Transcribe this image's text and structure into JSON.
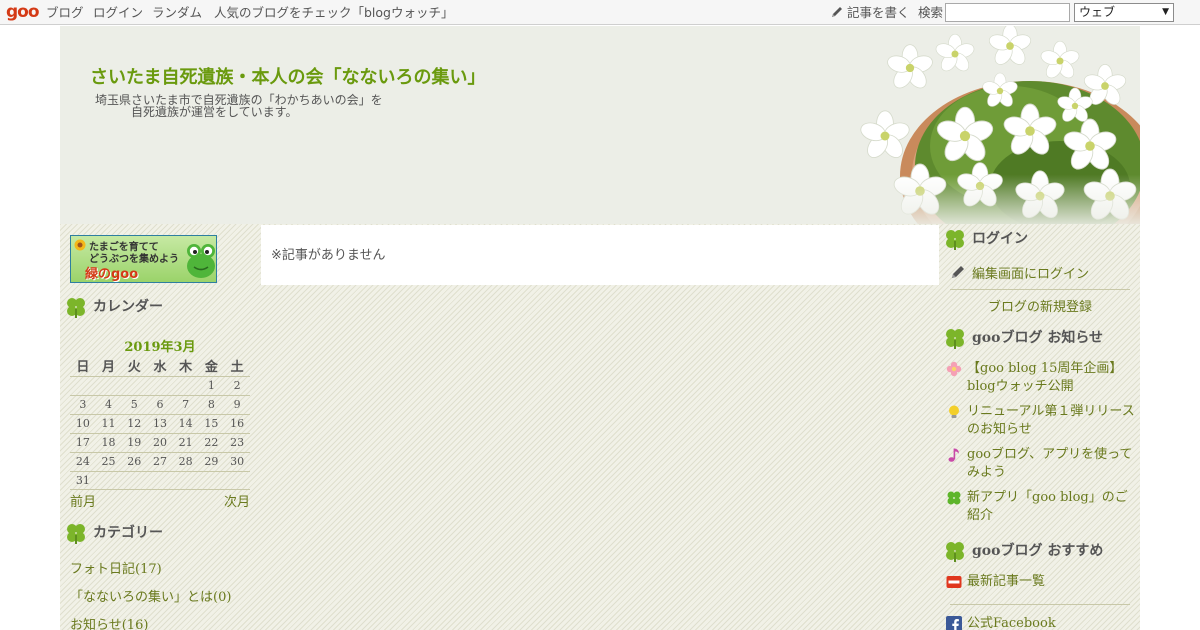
{
  "topbar": {
    "logo": "goo",
    "nav": [
      "ブログ",
      "ログイン",
      "ランダム"
    ],
    "promo": "人気のブログをチェック「blogウォッチ」",
    "write": "記事を書く",
    "search_label": "検索",
    "search_value": "",
    "search_scope": "ウェブ"
  },
  "header": {
    "title": "さいたま自死遺族・本人の会「なないろの集い」",
    "desc_line1": "埼玉県さいたま市で自死遺族の「わかちあいの会」を",
    "desc_line2": "自死遺族が運営をしています。"
  },
  "banner": {
    "line1": "たまごを育てて",
    "line2": "どうぶつを集めよう",
    "line3": "緑のgoo"
  },
  "calendar": {
    "heading": "カレンダー",
    "month": "2019年3月",
    "weekdays": [
      "日",
      "月",
      "火",
      "水",
      "木",
      "金",
      "土"
    ],
    "weeks": [
      [
        "",
        "",
        "",
        "",
        "",
        "1",
        "2"
      ],
      [
        "3",
        "4",
        "5",
        "6",
        "7",
        "8",
        "9"
      ],
      [
        "10",
        "11",
        "12",
        "13",
        "14",
        "15",
        "16"
      ],
      [
        "17",
        "18",
        "19",
        "20",
        "21",
        "22",
        "23"
      ],
      [
        "24",
        "25",
        "26",
        "27",
        "28",
        "29",
        "30"
      ],
      [
        "31",
        "",
        "",
        "",
        "",
        "",
        ""
      ]
    ],
    "prev": "前月",
    "next": "次月"
  },
  "categories": {
    "heading": "カテゴリー",
    "items": [
      "フォト日記(17)",
      "「なないろの集い」とは(0)",
      "お知らせ(16)"
    ]
  },
  "main": {
    "empty_message": "※記事がありません"
  },
  "login_box": {
    "heading": "ログイン",
    "edit_login": "編集画面にログイン",
    "register": "ブログの新規登録"
  },
  "news": {
    "heading": "gooブログ お知らせ",
    "items": [
      "【goo blog 15周年企画】blogウォッチ公開",
      "リニューアル第１弾リリースのお知らせ",
      "gooブログ、アプリを使ってみよう",
      "新アプリ「goo blog」のご紹介"
    ]
  },
  "recommend": {
    "heading": "gooブログ おすすめ",
    "items": [
      "最新記事一覧",
      "公式Facebook"
    ]
  },
  "colors": {
    "accent_green": "#6a9a0e",
    "link_olive": "#6a7a1e",
    "promo_orange": "#e0551e",
    "logo_red": "#d43a16"
  }
}
